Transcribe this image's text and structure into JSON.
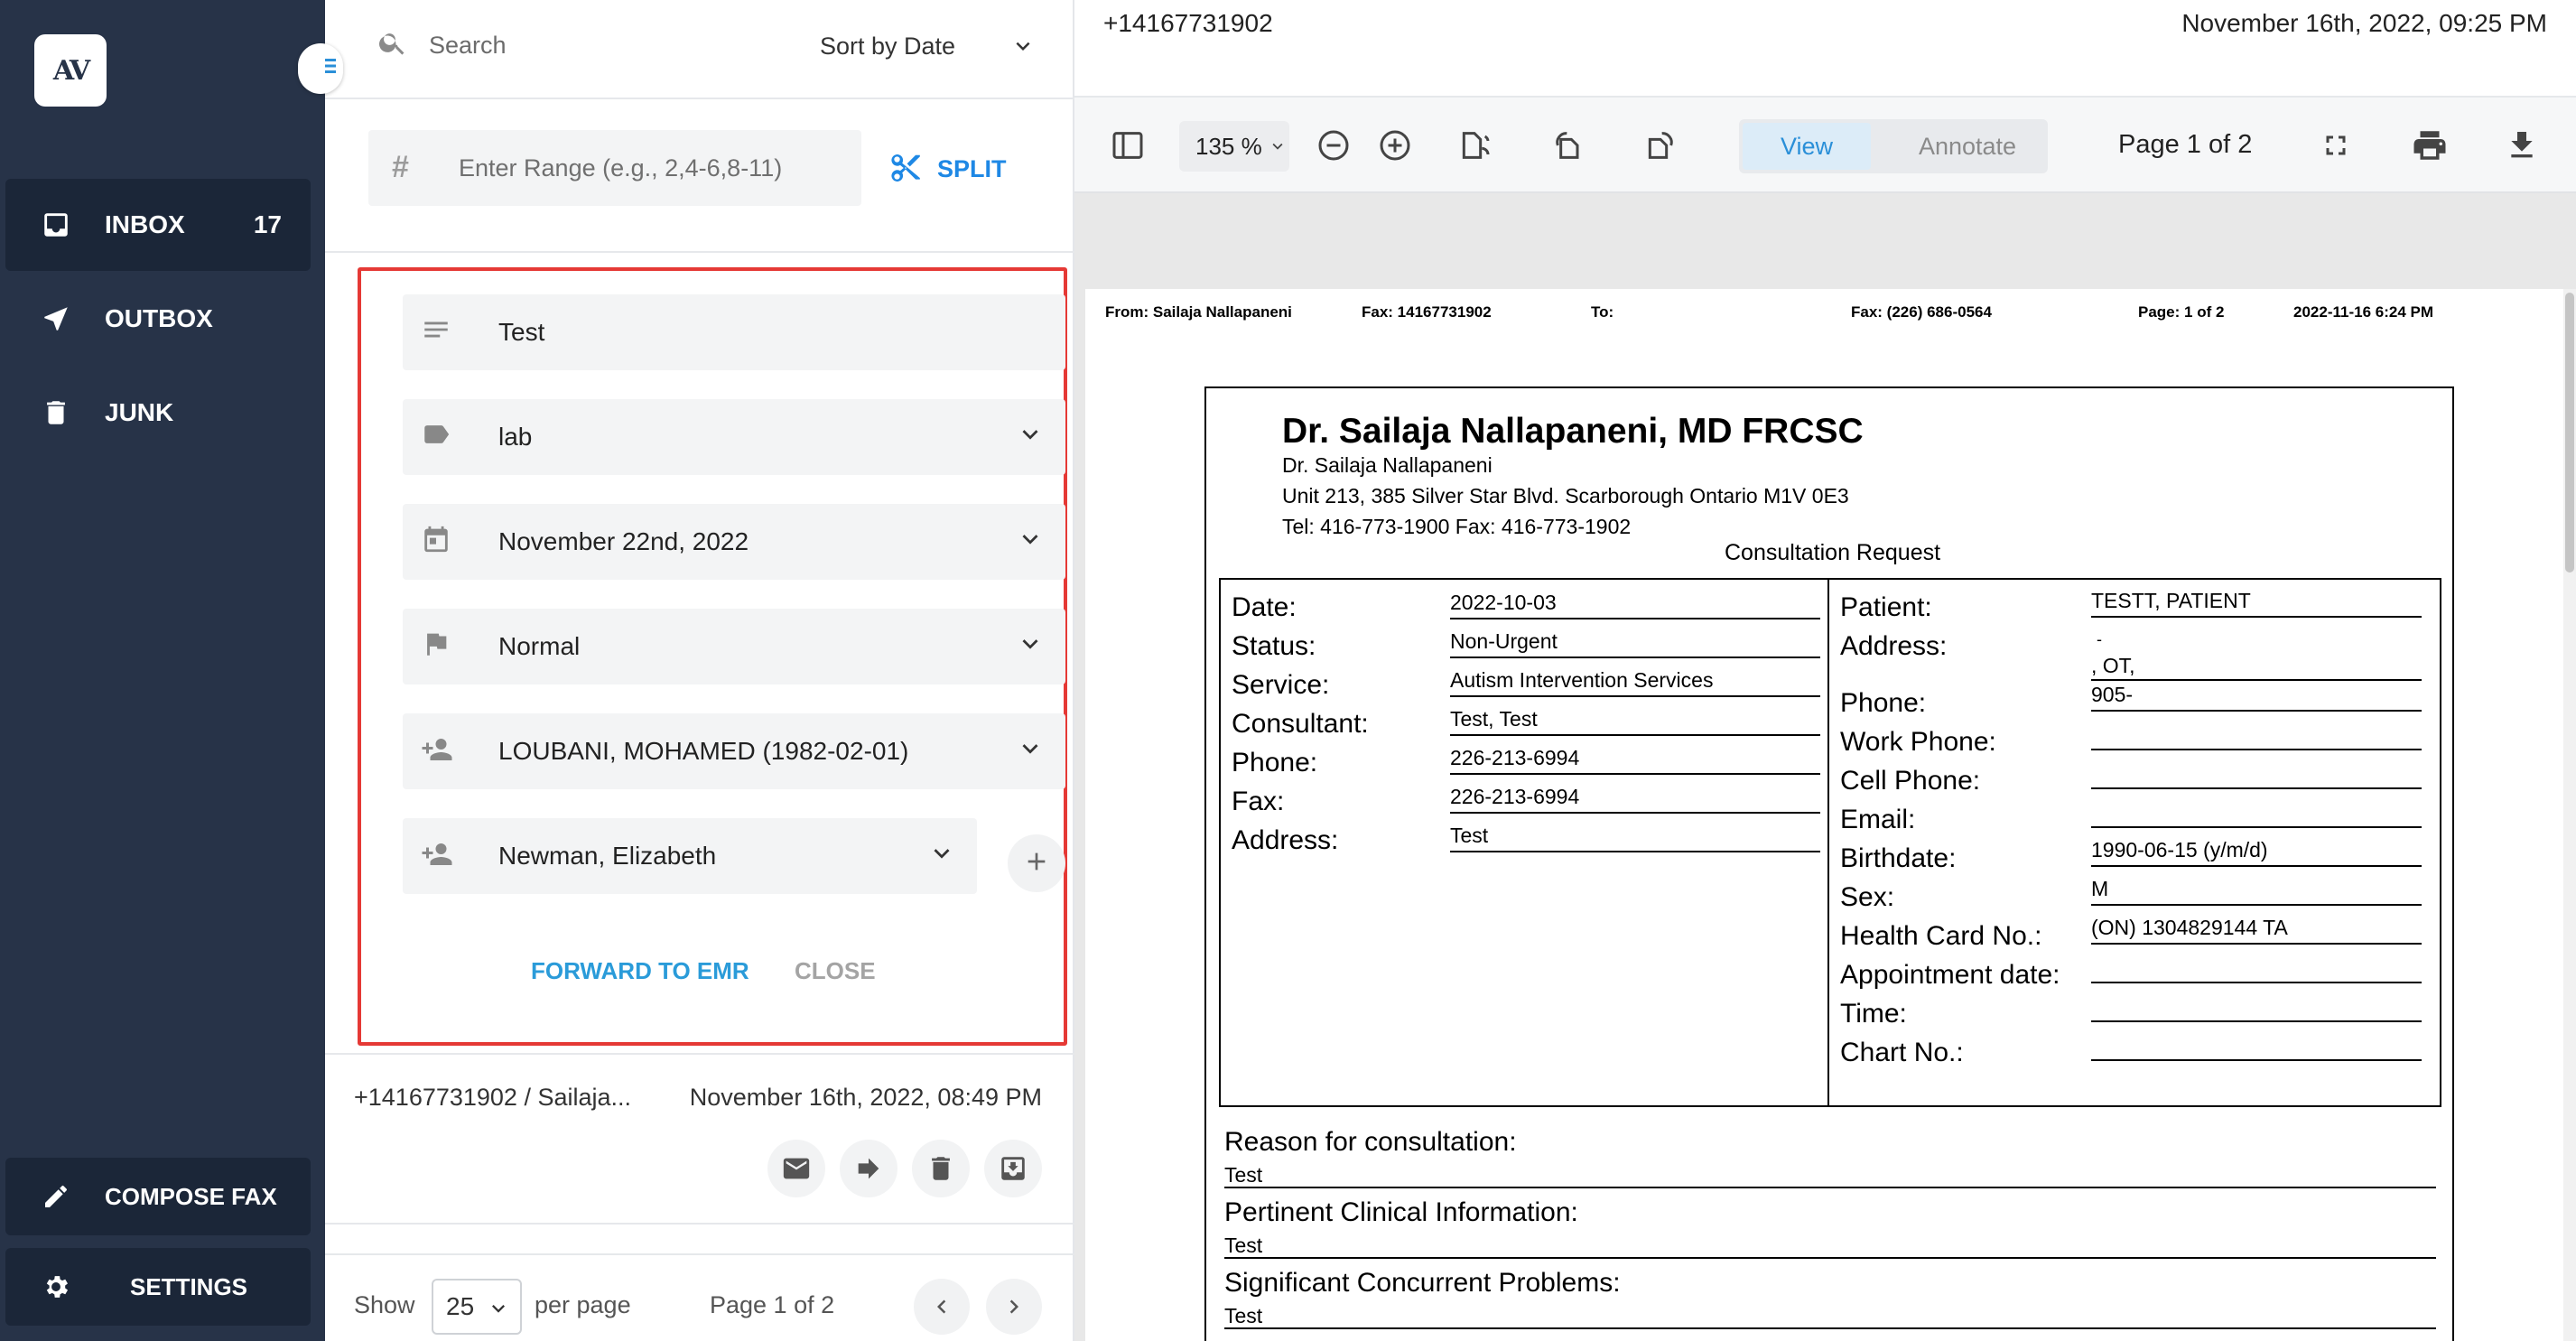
{
  "sidebar": {
    "logo_text": "AV",
    "nav": [
      {
        "label": "INBOX",
        "count": "17",
        "icon": "inbox-icon",
        "active": true
      },
      {
        "label": "OUTBOX",
        "icon": "send-icon"
      },
      {
        "label": "JUNK",
        "icon": "trash-icon"
      }
    ],
    "compose_label": "COMPOSE FAX",
    "settings_label": "SETTINGS"
  },
  "list": {
    "search_placeholder": "Search",
    "sort_label": "Sort by Date",
    "range_placeholder": "Enter Range (e.g., 2,4-6,8-11)",
    "split_label": "SPLIT"
  },
  "edit": {
    "title_value": "Test",
    "category_value": "lab",
    "date_value": "November 22nd, 2022",
    "priority_value": "Normal",
    "patient_value": "LOUBANI, MOHAMED (1982-02-01)",
    "provider_value": "Newman, Elizabeth",
    "forward_label": "FORWARD TO EMR",
    "close_label": "CLOSE"
  },
  "fax_item": {
    "from": "+14167731902 / Sailaja...",
    "date": "November 16th, 2022, 08:49 PM"
  },
  "pager": {
    "show_label": "Show",
    "per_page_value": "25",
    "per_page_label": "per page",
    "page_label": "Page 1 of 2"
  },
  "viewer": {
    "fax_number": "+14167731902",
    "received": "November 16th, 2022, 09:25 PM",
    "zoom": "135 %",
    "view_label": "View",
    "annotate_label": "Annotate",
    "page_indicator": "Page 1 of 2"
  },
  "document": {
    "header": {
      "from": "From: Sailaja Nallapaneni",
      "fax": "Fax: 14167731902",
      "to": "To:",
      "fax_to": "Fax: (226) 686-0564",
      "page": "Page: 1 of 2",
      "datetime": "2022-11-16 6:24 PM"
    },
    "doctor_name": "Dr. Sailaja Nallapaneni, MD FRCSC",
    "doctor_sub": "Dr. Sailaja Nallapaneni",
    "address": "Unit 213,  385 Silver Star Blvd.   Scarborough  Ontario  M1V 0E3",
    "tel": "Tel: 416-773-1900 Fax: 416-773-1902",
    "form_title": "Consultation Request",
    "left_fields": [
      {
        "label": "Date:",
        "value": "2022-10-03"
      },
      {
        "label": "Status:",
        "value": "Non-Urgent"
      },
      {
        "label": "Service:",
        "value": "Autism Intervention Services"
      },
      {
        "label": "Consultant:",
        "value": "Test, Test"
      },
      {
        "label": "Phone:",
        "value": "226-213-6994"
      },
      {
        "label": "Fax:",
        "value": "226-213-6994"
      },
      {
        "label": "Address:",
        "value": "Test"
      }
    ],
    "right_fields": [
      {
        "label": "Patient:",
        "value": "TESTT, PATIENT"
      },
      {
        "label": "Address:",
        "value": ", OT,"
      },
      {
        "label": "Phone:",
        "value": "905-"
      },
      {
        "label": "Work Phone:",
        "value": ""
      },
      {
        "label": "Cell Phone:",
        "value": ""
      },
      {
        "label": "Email:",
        "value": ""
      },
      {
        "label": "Birthdate:",
        "value": "1990-06-15 (y/m/d)"
      },
      {
        "label": "Sex:",
        "value": "M"
      },
      {
        "label": "Health Card No.:",
        "value": "(ON) 1304829144 TA"
      },
      {
        "label": "Appointment date:",
        "value": ""
      },
      {
        "label": "Time:",
        "value": ""
      },
      {
        "label": "Chart No.:",
        "value": ""
      }
    ],
    "address_dash": "-",
    "sections": [
      {
        "label": "Reason for consultation:",
        "value": "Test"
      },
      {
        "label": "Pertinent Clinical Information:",
        "value": "Test"
      },
      {
        "label": "Significant Concurrent Problems:",
        "value": "Test"
      }
    ]
  }
}
